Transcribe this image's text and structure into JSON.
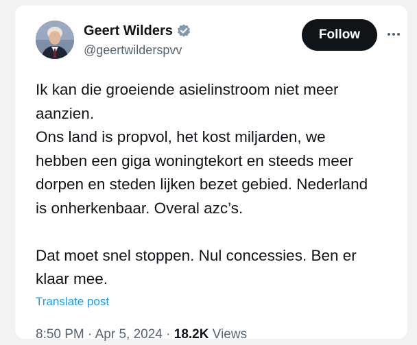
{
  "author": {
    "display_name": "Geert Wilders",
    "handle": "@geertwilderspvv",
    "verified": true
  },
  "follow_button": {
    "label": "Follow"
  },
  "more_menu": {
    "icon": "more-horizontal-icon"
  },
  "tweet": {
    "lines": [
      "Ik kan die groeiende asielinstroom niet meer",
      "aanzien.",
      "Ons land is propvol, het kost miljarden, we",
      "hebben een giga woningtekort en steeds meer",
      "dorpen en steden lijken bezet gebied. Nederland",
      "is onherkenbaar. Overal azc’s.",
      "Dat moet snel stoppen. Nul concessies. Ben er",
      "klaar mee."
    ]
  },
  "translate_label": "Translate post",
  "meta": {
    "time": "8:50 PM",
    "separator": "·",
    "date": "Apr 5, 2024",
    "views_count": "18.2K",
    "views_label": "Views"
  },
  "colors": {
    "accent": "#1d9bf0",
    "text": "#0f1419",
    "secondary": "#536471",
    "follow_bg": "#0f1419"
  }
}
